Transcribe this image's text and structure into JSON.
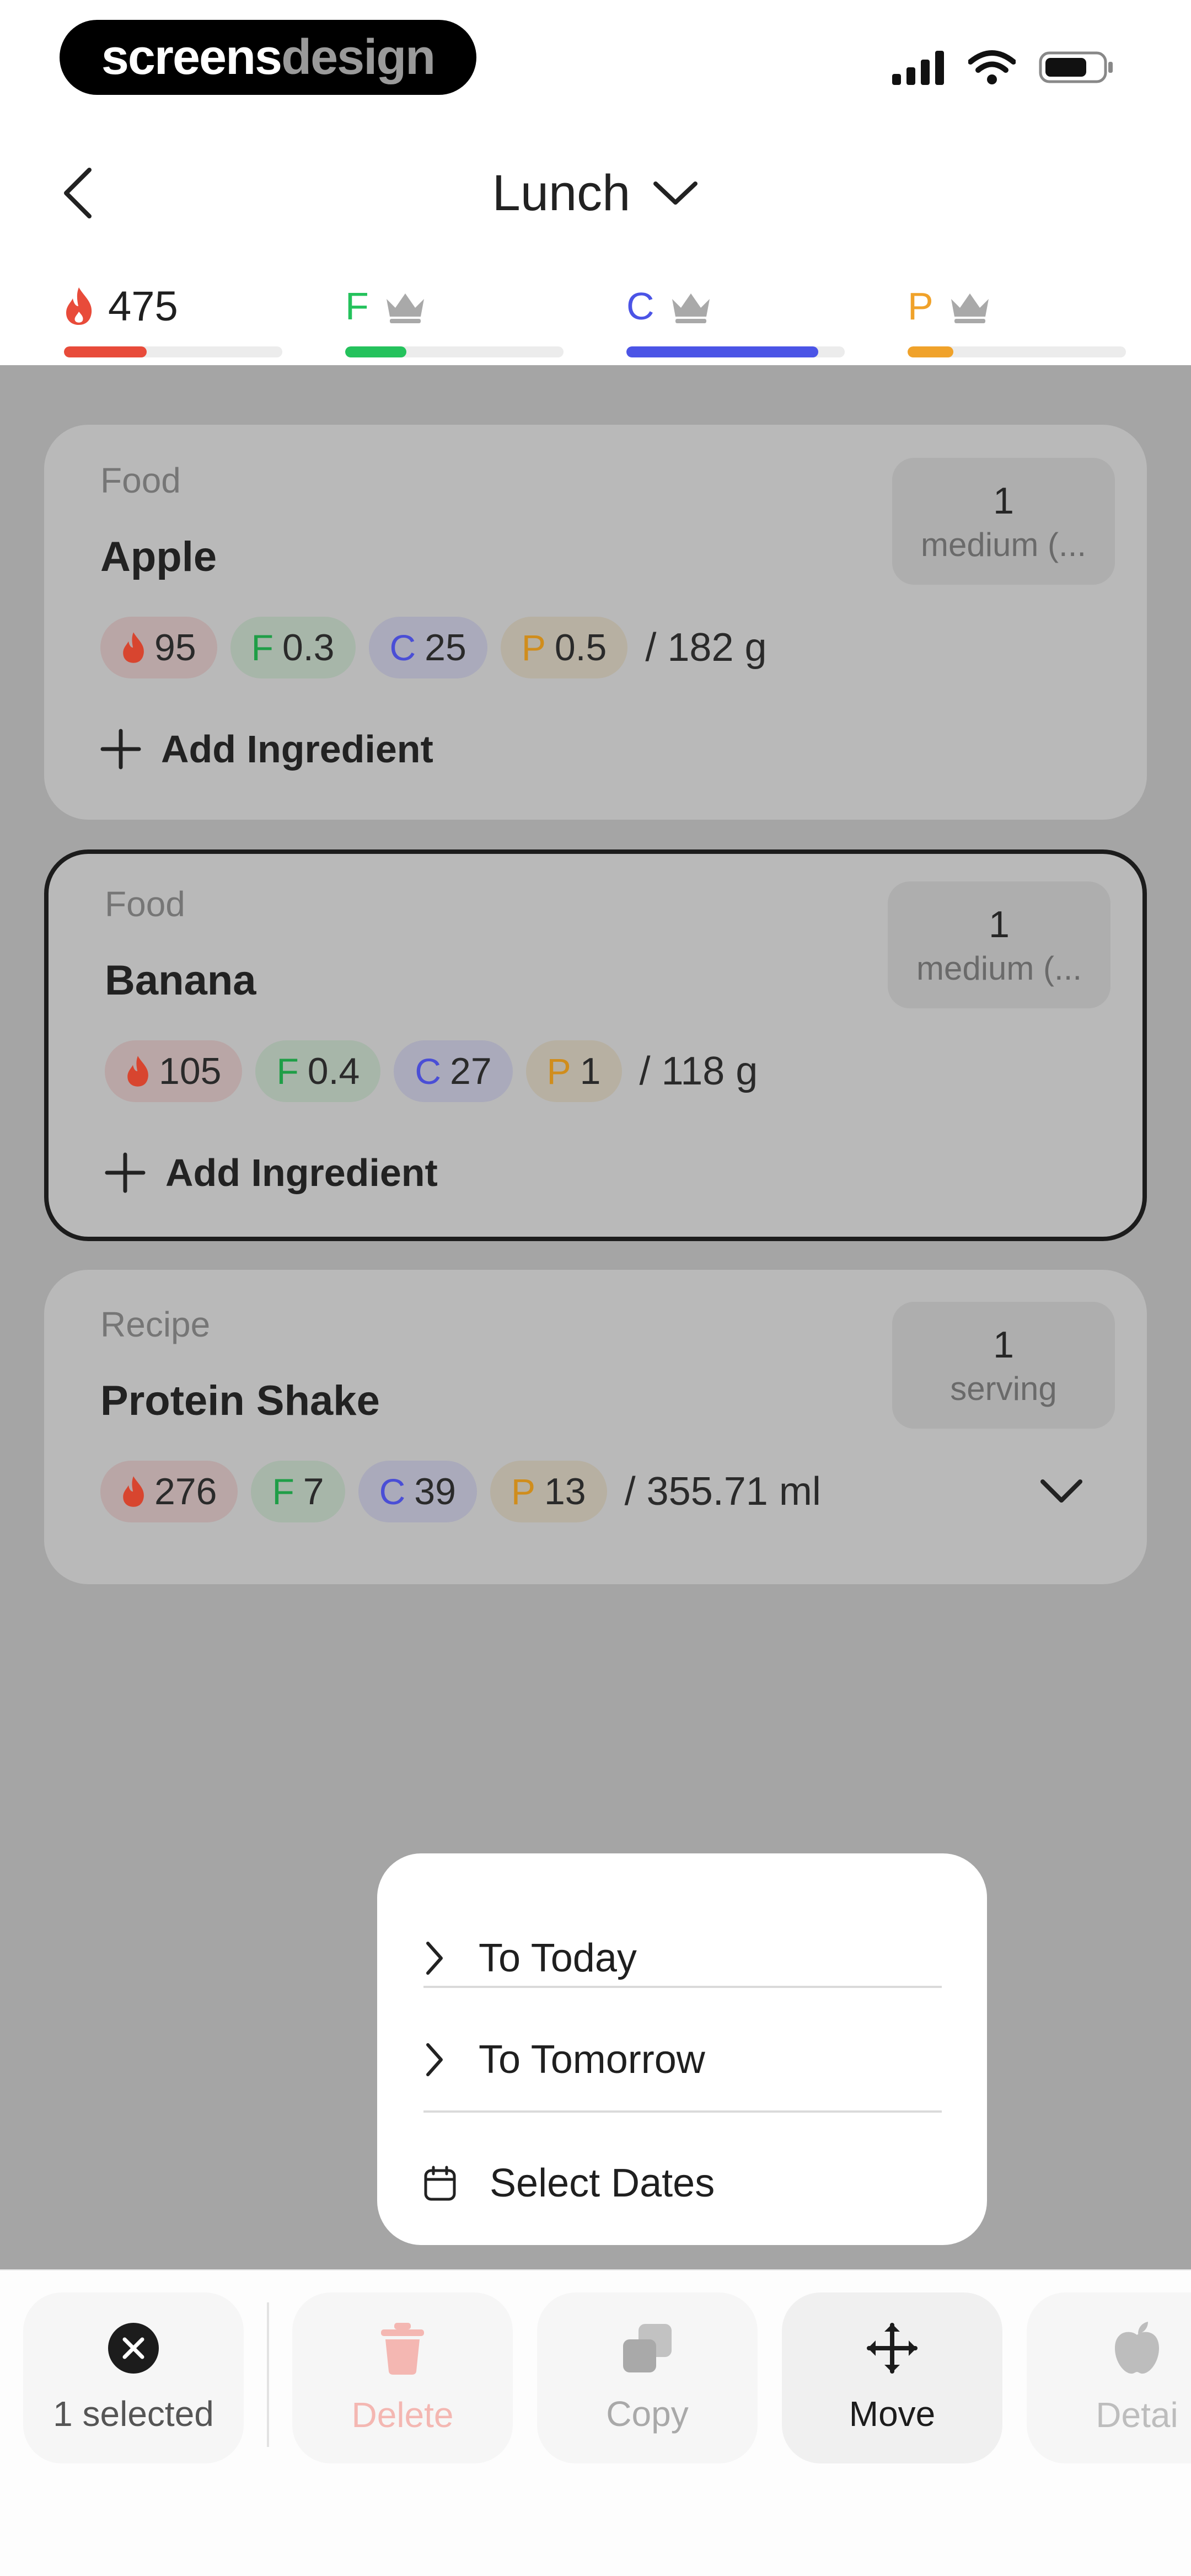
{
  "status_bar": {
    "brand_part1": "screens",
    "brand_part2": "design"
  },
  "header": {
    "title": "Lunch"
  },
  "macros": {
    "calories": {
      "value": "475",
      "progress": 0.38,
      "color": "#e84b3a"
    },
    "fat": {
      "letter": "F",
      "progress": 0.28,
      "color": "#24c25c"
    },
    "carbs": {
      "letter": "C",
      "progress": 0.88,
      "color": "#4b54e6"
    },
    "protein": {
      "letter": "P",
      "progress": 0.21,
      "color": "#f0a22a"
    }
  },
  "items": [
    {
      "kind": "Food",
      "name": "Apple",
      "qty_number": "1",
      "qty_unit": "medium (...",
      "kcal": "95",
      "fat_letter": "F",
      "fat": "0.3",
      "carb_letter": "C",
      "carb": "25",
      "prot_letter": "P",
      "prot": "0.5",
      "weight": "/ 182 g",
      "add_label": "Add Ingredient"
    },
    {
      "kind": "Food",
      "name": "Banana",
      "qty_number": "1",
      "qty_unit": "medium (...",
      "kcal": "105",
      "fat_letter": "F",
      "fat": "0.4",
      "carb_letter": "C",
      "carb": "27",
      "prot_letter": "P",
      "prot": "1",
      "weight": "/ 118 g",
      "add_label": "Add Ingredient"
    },
    {
      "kind": "Recipe",
      "name": "Protein Shake",
      "qty_number": "1",
      "qty_unit": "serving",
      "kcal": "276",
      "fat_letter": "F",
      "fat": "7",
      "carb_letter": "C",
      "carb": "39",
      "prot_letter": "P",
      "prot": "13",
      "weight": "/ 355.71 ml"
    }
  ],
  "popup_menu": {
    "items": [
      {
        "label": "To Today",
        "icon": "chevron-right-icon"
      },
      {
        "label": "To Tomorrow",
        "icon": "chevron-right-icon"
      },
      {
        "label": "Select Dates",
        "icon": "calendar-icon"
      }
    ]
  },
  "action_bar": {
    "selected_label": "1 selected",
    "delete_label": "Delete",
    "copy_label": "Copy",
    "move_label": "Move",
    "details_label": "Detai"
  }
}
